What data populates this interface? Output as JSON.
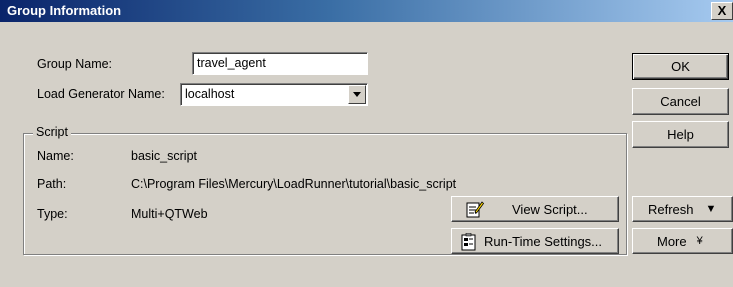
{
  "window": {
    "title": "Group Information",
    "close_glyph": "X"
  },
  "form": {
    "group_name_label": "Group Name:",
    "group_name_value": "travel_agent",
    "load_gen_label": "Load Generator Name:",
    "load_gen_value": "localhost"
  },
  "script": {
    "legend": "Script",
    "name_label": "Name:",
    "name_value": "basic_script",
    "path_label": "Path:",
    "path_value": "C:\\Program Files\\Mercury\\LoadRunner\\tutorial\\basic_script",
    "type_label": "Type:",
    "type_value": "Multi+QTWeb",
    "view_script_label": "View Script...",
    "runtime_label": "Run-Time Settings..."
  },
  "buttons": {
    "ok": "OK",
    "cancel": "Cancel",
    "help": "Help",
    "refresh": "Refresh",
    "refresh_arrow": "▼",
    "more": "More",
    "more_arrow": "¥"
  }
}
